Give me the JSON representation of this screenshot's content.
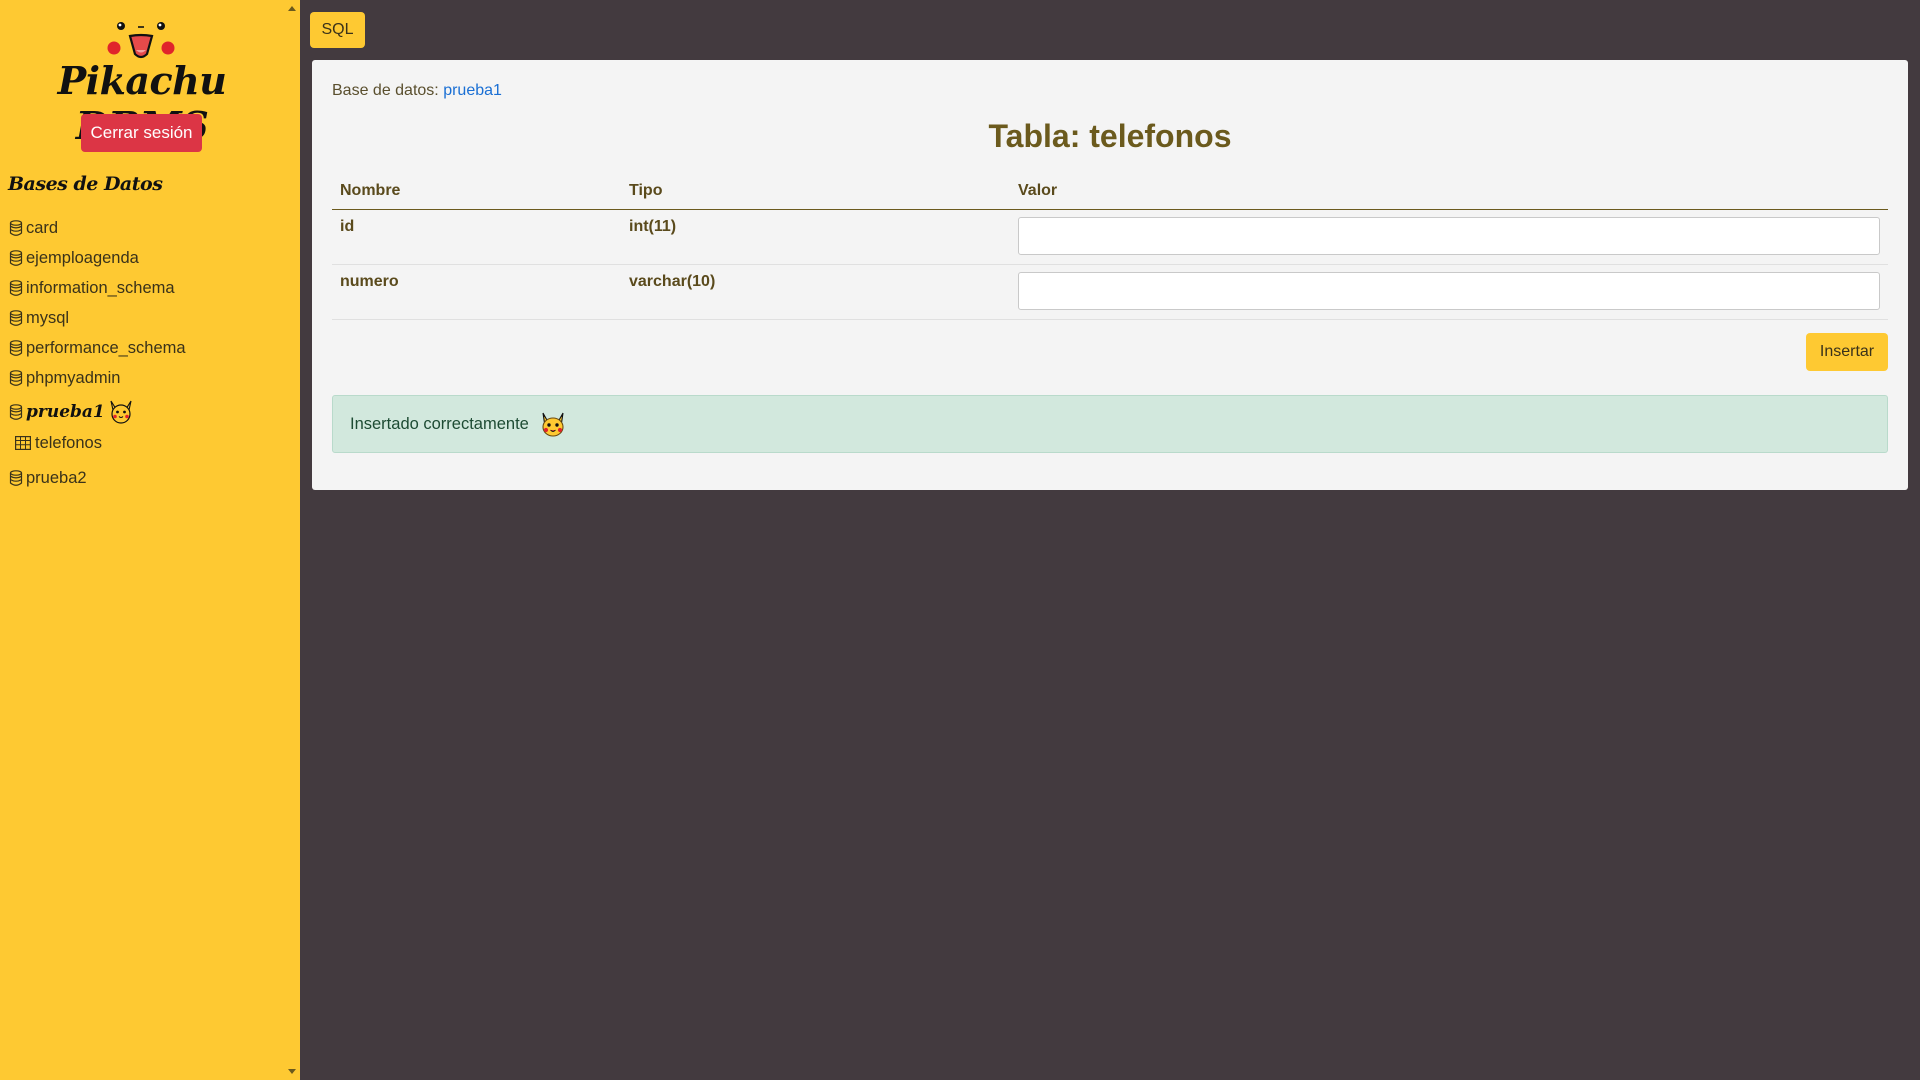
{
  "sidebar": {
    "app_title": "Pikachu DBMS",
    "logout_label": "Cerrar sesión",
    "databases_heading": "Bases de Datos",
    "databases": [
      {
        "name": "card"
      },
      {
        "name": "ejemploagenda"
      },
      {
        "name": "information_schema"
      },
      {
        "name": "mysql"
      },
      {
        "name": "performance_schema"
      },
      {
        "name": "phpmyadmin"
      },
      {
        "name": "prueba1",
        "active": true,
        "tables": [
          "telefonos"
        ]
      },
      {
        "name": "prueba2"
      }
    ]
  },
  "toolbar": {
    "sql_label": "SQL"
  },
  "main": {
    "database_label": "Base de datos:",
    "database_name": "prueba1",
    "table_title": "Tabla: telefonos",
    "columns": [
      "Nombre",
      "Tipo",
      "Valor"
    ],
    "rows": [
      {
        "name": "id",
        "type": "int(11)",
        "value": ""
      },
      {
        "name": "numero",
        "type": "varchar(10)",
        "value": ""
      }
    ],
    "insert_label": "Insertar",
    "alert_message": "Insertado correctamente"
  },
  "colors": {
    "sidebar_bg": "#fec932",
    "page_bg": "#433a3f",
    "danger": "#dc3545",
    "success_bg": "#d2e8dd",
    "link": "#1a6fd4"
  },
  "icons": [
    "pikachu-face-logo",
    "database-icon",
    "table-grid-icon",
    "pikachu-icon"
  ]
}
